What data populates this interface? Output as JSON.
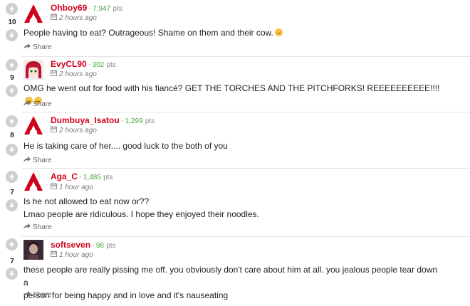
{
  "comments": [
    {
      "votes": "10",
      "username": "Ohboy69",
      "points": "7,947",
      "pts_label": "pts",
      "time": "2 hours ago",
      "text": "People having to eat? Outrageous! Shame on them and their cow.",
      "text_line2": "",
      "emojis": 1,
      "avatar": "a-logo",
      "share_label": "Share"
    },
    {
      "votes": "9",
      "username": "EvyCL90",
      "points": "302",
      "pts_label": "pts",
      "time": "2 hours ago",
      "text": "OMG he went out for food with his fiancé? GET THE TORCHES AND THE PITCHFORKS! REEEEEEEEEE!!!!",
      "text_line2": "",
      "emojis": 2,
      "avatar": "anime-girl",
      "share_label": "Share"
    },
    {
      "votes": "8",
      "username": "Dumbuya_Isatou",
      "points": "1,299",
      "pts_label": "pts",
      "time": "2 hours ago",
      "text": "He is taking care of her.... good luck to the both of you",
      "text_line2": "",
      "emojis": 0,
      "avatar": "a-logo",
      "share_label": "Share"
    },
    {
      "votes": "7",
      "username": "Aga_C",
      "points": "1,485",
      "pts_label": "pts",
      "time": "1 hour ago",
      "text": "Is he not allowed to eat now or??",
      "text_line2": "Lmao people are ridiculous. I hope they enjoyed their noodles.",
      "emojis": 0,
      "avatar": "a-logo",
      "share_label": "Share"
    },
    {
      "votes": "7",
      "username": "softseven",
      "points": "98",
      "pts_label": "pts",
      "time": "1 hour ago",
      "text": "these people are really pissing me off. you obviously don't care about him at all. you jealous people tear down a",
      "text_line2": "person for being happy and in love and it's nauseating",
      "emojis": 0,
      "avatar": "photo",
      "share_label": "Share"
    }
  ],
  "colors": {
    "username": "#d0021b",
    "points": "#4aa63f",
    "vote_button": "#cfcfcf",
    "logo_red": "#d0021b"
  }
}
